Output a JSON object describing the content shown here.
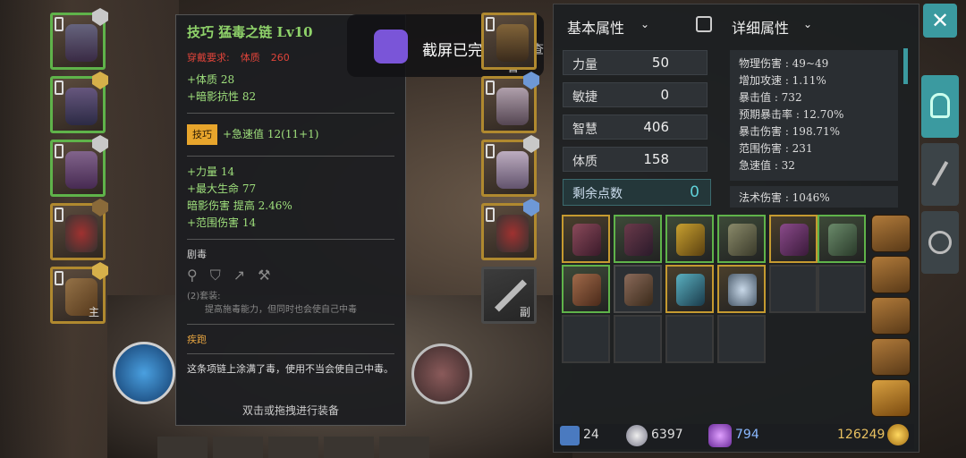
{
  "notification": {
    "title": "截屏已完成",
    "action": "点击查看"
  },
  "tooltip": {
    "title": "技巧 猛毒之链 Lv10",
    "requirement": {
      "label": "穿戴要求:",
      "stat": "体质",
      "value": "260"
    },
    "base_stats": [
      "+体质 28",
      "+暗影抗性 82"
    ],
    "skill": {
      "tag": "技巧",
      "text": "+急速值 12(11+1)"
    },
    "bonus_stats": [
      "+力量 14",
      "+最大生命 77",
      "暗影伤害 提高 2.46%",
      "+范围伤害 14"
    ],
    "set_name": "剧毒",
    "set_bonus_label": "(2)套装:",
    "set_bonus_text": "提高施毒能力，但同时也会使自己中毒",
    "set2_name": "疾跑",
    "description": "这条项链上涂满了毒，使用不当会使自己中毒。",
    "hint": "双击或拖拽进行装备"
  },
  "weapon_slot": {
    "tag": "主"
  },
  "offhand_slot": {
    "tag": "副"
  },
  "basic": {
    "header": "基本属性",
    "stats": [
      {
        "label": "力量",
        "value": "50"
      },
      {
        "label": "敏捷",
        "value": "0"
      },
      {
        "label": "智慧",
        "value": "406"
      },
      {
        "label": "体质",
        "value": "158"
      }
    ],
    "remaining_label": "剩余点数",
    "remaining_value": "0"
  },
  "detail": {
    "header": "详细属性",
    "lines": [
      "物理伤害 : 49~49",
      "增加攻速 : 1.11%",
      "暴击值 : 732",
      "预期暴击率 : 12.70%",
      "暴击伤害 : 198.71%",
      "范围伤害 : 231",
      "急速值 : 32"
    ],
    "extra": "法术伤害 : 1046%"
  },
  "currency": {
    "a": "24",
    "b": "6397",
    "c": "794",
    "gold": "126249"
  },
  "colors": {
    "green": "#5fb34a",
    "gold": "#c59a30",
    "accent": "#3b9aa0"
  }
}
